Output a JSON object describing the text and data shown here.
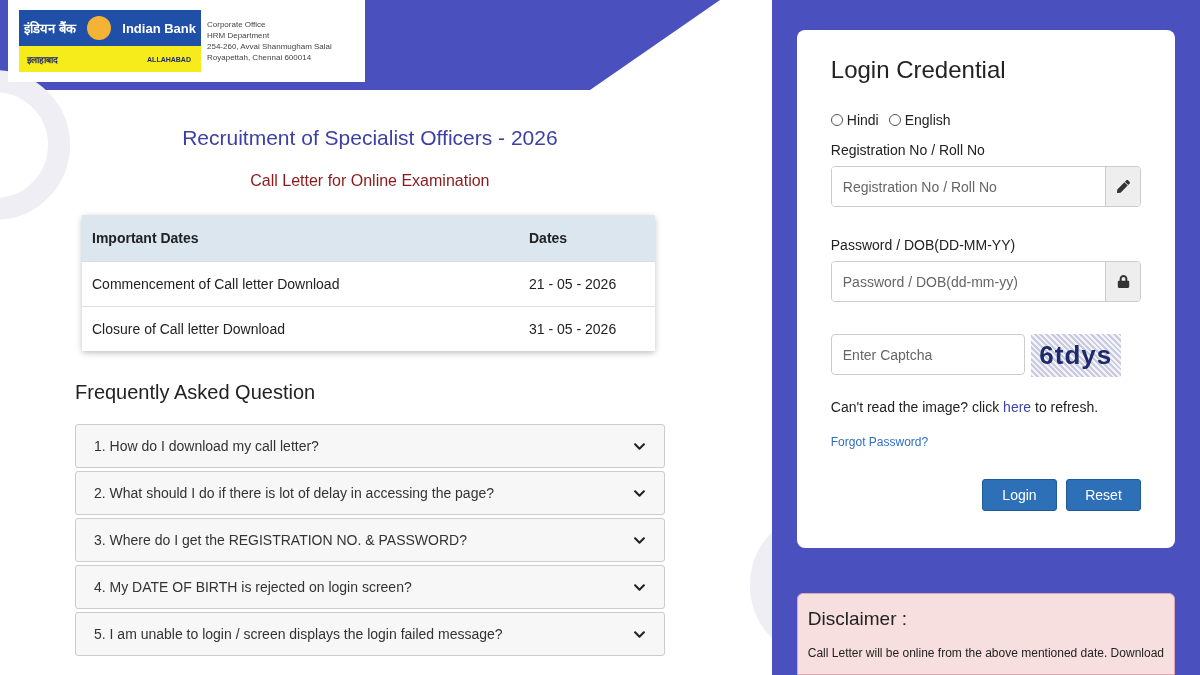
{
  "logo": {
    "hindi_name": "इंडियन बैंक",
    "english_name": "Indian Bank",
    "hindi_sub": "इलाहाबाद",
    "english_sub": "ALLAHABAD"
  },
  "address": [
    "Corporate Office",
    "HRM Department",
    "254-260, Avvai Shanmugham Salai",
    "Royapettah, Chennai 600014"
  ],
  "title": "Recruitment of Specialist Officers - 2026",
  "subtitle": "Call Letter for Online Examination",
  "dates_table": {
    "columns": [
      "Important Dates",
      "Dates"
    ],
    "rows": [
      {
        "event": "Commencement of Call letter Download",
        "date": "21 - 05 - 2026"
      },
      {
        "event": "Closure of Call letter Download",
        "date": "31 - 05 - 2026"
      }
    ]
  },
  "faq": {
    "heading": "Frequently Asked Question",
    "items": [
      {
        "question": "1. How do I download my call letter?",
        "expanded": false
      },
      {
        "question": "2. What should I do if there is lot of delay in accessing the page?",
        "expanded": false
      },
      {
        "question": "3. Where do I get the REGISTRATION NO. & PASSWORD?",
        "expanded": false
      },
      {
        "question": "4. My DATE OF BIRTH is rejected on login screen?",
        "expanded": false
      },
      {
        "question": "5. I am unable to login / screen displays the login failed message?",
        "expanded": false
      }
    ]
  },
  "login": {
    "title": "Login Credential",
    "languages": [
      {
        "label": "Hindi",
        "selected": false
      },
      {
        "label": "English",
        "selected": false
      }
    ],
    "registration": {
      "label": "Registration No / Roll No",
      "placeholder": "Registration No / Roll No"
    },
    "password": {
      "label": "Password / DOB(DD-MM-YY)",
      "placeholder": "Password / DOB(dd-mm-yy)"
    },
    "captcha": {
      "placeholder": "Enter Captcha",
      "code": "6tdys"
    },
    "refresh_text": {
      "before": "Can't read the image? click",
      "link": "here",
      "after": "to refresh."
    },
    "forgot": "Forgot Password?",
    "buttons": [
      "Login",
      "Reset"
    ]
  },
  "disclaimer": {
    "title": "Disclaimer :",
    "text": "Call Letter will be online from the above mentioned date. Download"
  }
}
